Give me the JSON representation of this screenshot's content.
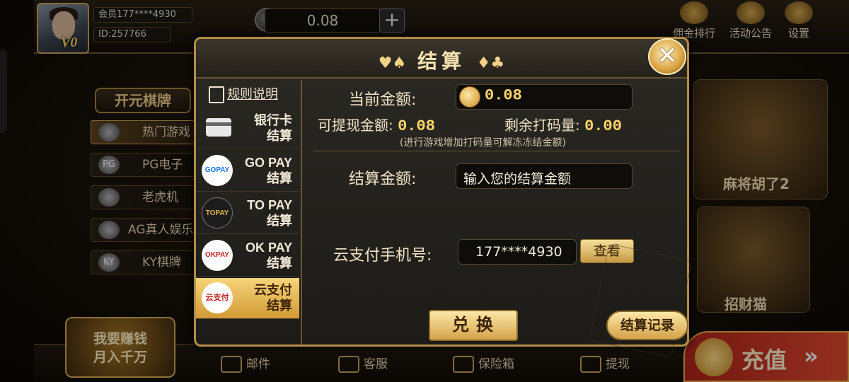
{
  "header": {
    "member": "会员177****4930",
    "user_id": "ID:257766",
    "vip_level": "V0",
    "balance": "0.08",
    "plus": "+",
    "top_icons": [
      "佣金排行",
      "活动公告",
      "设置"
    ]
  },
  "lobby": {
    "brand": "开元棋牌",
    "nav": [
      "热门游戏",
      "PG电子",
      "老虎机",
      "AG真人娱乐",
      "KY棋牌"
    ],
    "nav_icons": [
      "",
      "PG",
      "",
      "",
      "KY"
    ],
    "games": [
      "麻将胡了2",
      "招财猫"
    ],
    "bottom": [
      "邮件",
      "客服",
      "保险箱",
      "提现"
    ],
    "promo": [
      "我要赚钱",
      "月入千万"
    ],
    "recharge": "充值",
    "recharge_arrow": "»"
  },
  "modal": {
    "title": "结算",
    "suit_left": "♥♠",
    "suit_right": "♦♣",
    "close": "✕",
    "rules": "规则说明",
    "methods": [
      {
        "line1": "银行卡",
        "line2": "结算",
        "icon": "bank-card"
      },
      {
        "line1": "GO PAY",
        "line2": "结算",
        "icon": "GOPAY"
      },
      {
        "line1": "TO PAY",
        "line2": "结算",
        "icon": "TOPAY"
      },
      {
        "line1": "OK PAY",
        "line2": "结算",
        "icon": "OKPAY"
      },
      {
        "line1": "云支付",
        "line2": "结算",
        "icon": "云支付"
      }
    ],
    "current_amount_label": "当前金额:",
    "current_amount": "0.08",
    "withdrawable_label": "可提现金额:",
    "withdrawable": "0.08",
    "remaining_label": "剩余打码量:",
    "remaining": "0.00",
    "hint": "(进行游戏增加打码量可解冻冻结金额)",
    "settle_label": "结算金额:",
    "settle_placeholder": "输入您的结算金额",
    "phone_label": "云支付手机号:",
    "phone": "177****4930",
    "view": "查看",
    "exchange": "兑换",
    "record": "结算记录"
  }
}
